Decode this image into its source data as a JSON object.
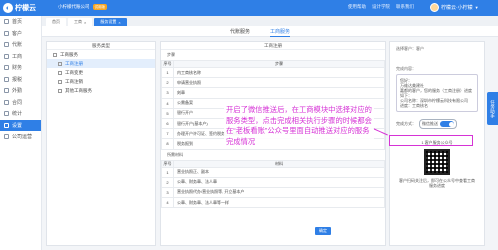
{
  "topbar": {
    "logo_text": "柠檬云",
    "company": "小柠檬代账公司",
    "company_badge": "试用版",
    "nav_help": "使用帮助",
    "nav_settings": "设计学院",
    "nav_contact": "联系我们",
    "user_name": "柠檬云·小柠檬"
  },
  "sidebar": {
    "items": [
      {
        "label": "首页"
      },
      {
        "label": "客户"
      },
      {
        "label": "代账"
      },
      {
        "label": "工商"
      },
      {
        "label": "财务"
      },
      {
        "label": "报税"
      },
      {
        "label": "外勤"
      },
      {
        "label": "合同"
      },
      {
        "label": "统计"
      },
      {
        "label": "设置"
      },
      {
        "label": "公司运营"
      }
    ]
  },
  "tabs": [
    "首页",
    "工商",
    "服务设置"
  ],
  "service_tabs": {
    "agency": "代账服务",
    "business": "工商服务"
  },
  "left_panel": {
    "title": "服务类型",
    "categories": [
      "工商服务",
      "工商注册",
      "工商变更",
      "工商注销",
      "其他工商服务"
    ]
  },
  "mid_panel": {
    "title": "工商注册",
    "section1": "步骤",
    "col_num": "序号",
    "col_step": "步骤",
    "rows1": [
      {
        "num": "1",
        "step": "内工商核名称"
      },
      {
        "num": "2",
        "step": "申请营业执照"
      },
      {
        "num": "3",
        "step": "刻章"
      },
      {
        "num": "4",
        "step": "公需备案"
      },
      {
        "num": "5",
        "step": "银行开户"
      },
      {
        "num": "6",
        "step": "银行开户(基本户)"
      },
      {
        "num": "7",
        "step": "办理开户许可证、签约税务三方协议"
      },
      {
        "num": "8",
        "step": "税务报到"
      }
    ],
    "section2": "所需材料",
    "col_material": "材料",
    "rows2": [
      {
        "num": "1",
        "step": "营业执照正、副本"
      },
      {
        "num": "2",
        "step": "公章、财务章、法人章"
      },
      {
        "num": "3",
        "step": "营业执照代办/营业执照等, 开立基本户"
      },
      {
        "num": "4",
        "step": "公章、财务章、法人章等一样"
      }
    ],
    "confirm": "确定"
  },
  "right_panel": {
    "customer_label": "选择客户：客户",
    "preview_label": "完成内容：",
    "preview_card": [
      "您好：",
      "万维达美建社",
      "嘉都的客户，您的服务（工商注册）进度如下：",
      "公司名称：深圳市柠檬云科技有限公司",
      "进度：工商核名"
    ],
    "toggle_label": "完成方式：",
    "toggle_text": "微信推送",
    "qr_title": "1 客户服务公众号",
    "qr_caption": "客户扫码关注后，即可在公众号中查看工商服务进度"
  },
  "float_tab": "任务助手",
  "annotation": "开启了微信推送后，在工商模块中选择对应的服务类型，点击完成相关执行步骤的时候都会在“老板看账”公众号里面自动推送对应的服务完成情况"
}
